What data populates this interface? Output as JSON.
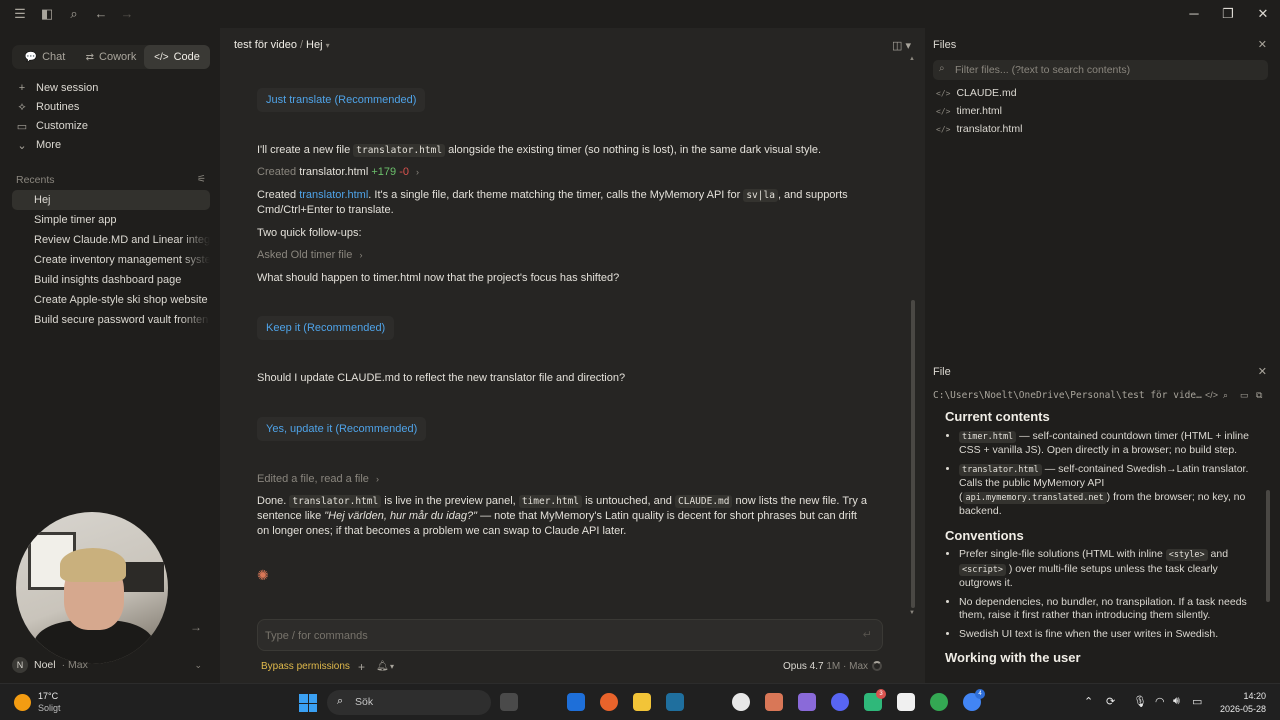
{
  "titlebar": {
    "icons": [
      "menu-icon",
      "sidebar-toggle-icon",
      "search-icon",
      "back-arrow-icon",
      "forward-arrow-icon"
    ],
    "window_controls": {
      "minimize": "─",
      "maximize": "❐",
      "close": "✕"
    }
  },
  "sidebar": {
    "tabs": [
      {
        "label": "Chat",
        "icon": "💬"
      },
      {
        "label": "Cowork",
        "icon": "⇄"
      },
      {
        "label": "Code",
        "icon": "</>",
        "active": true
      }
    ],
    "nav": [
      {
        "label": "New session",
        "icon": "+"
      },
      {
        "label": "Routines",
        "icon": "⟡"
      },
      {
        "label": "Customize",
        "icon": "▭"
      },
      {
        "label": "More",
        "icon": "⌄"
      }
    ],
    "recents_label": "Recents",
    "recents": [
      {
        "label": "Hej",
        "active": true
      },
      {
        "label": "Simple timer app"
      },
      {
        "label": "Review Claude.MD and Linear integr"
      },
      {
        "label": "Create inventory management syste"
      },
      {
        "label": "Build insights dashboard page"
      },
      {
        "label": "Create Apple-style ski shop website"
      },
      {
        "label": "Build secure password vault fronten"
      }
    ],
    "user": {
      "initial": "N",
      "name": "Noel",
      "plan": "Max"
    }
  },
  "main": {
    "breadcrumb": {
      "project": "test för video",
      "separator": "/",
      "session": "Hej"
    },
    "messages": {
      "opt_translate": "Just translate (Recommended)",
      "create_intro_1": "I'll create a new file",
      "create_intro_code": "translator.html",
      "create_intro_2": "alongside the existing timer (so nothing is lost), in the same dark visual style.",
      "created_label": "Created",
      "created_file": "translator.html",
      "created_add": "+179",
      "created_del": "-0",
      "summary_1": "Created",
      "summary_link": "translator.html",
      "summary_2": ". It's a single file, dark theme matching the timer, calls the MyMemory API for",
      "summary_code": "sv|la",
      "summary_3": ", and supports Cmd/Ctrl+Enter to translate.",
      "followups": "Two quick follow-ups:",
      "asked": "Asked Old timer file",
      "question1": "What should happen to timer.html now that the project's focus has shifted?",
      "opt_keep": "Keep it (Recommended)",
      "question2": "Should I update CLAUDE.md to reflect the new translator file and direction?",
      "opt_update": "Yes, update it (Recommended)",
      "edited": "Edited a file, read a file",
      "done_1": "Done.",
      "done_code1": "translator.html",
      "done_2": "is live in the preview panel,",
      "done_code2": "timer.html",
      "done_3": "is untouched, and",
      "done_code3": "CLAUDE.md",
      "done_4": "now lists the new file. Try a sentence like",
      "done_quote": "\"Hej världen, hur mår du idag?\"",
      "done_5": "— note that MyMemory's Latin quality is decent for short phrases but can drift on longer ones; if that becomes a problem we can swap to Claude API later."
    },
    "composer": {
      "placeholder": "Type / for commands"
    },
    "bottom": {
      "bypass": "Bypass permissions",
      "model": "Opus 4.7",
      "model_sub": "1M · Max"
    }
  },
  "files_panel": {
    "title": "Files",
    "search_placeholder": "Filter files... (?text to search contents)",
    "files": [
      "CLAUDE.md",
      "timer.html",
      "translator.html"
    ]
  },
  "file_panel": {
    "title": "File",
    "path": "C:\\Users\\Noelt\\OneDrive\\Personal\\test för video\\CLAUDE.md",
    "sections": {
      "current_heading": "Current contents",
      "c1_code": "timer.html",
      "c1_text": "— self-contained countdown timer (HTML + inline CSS + vanilla JS). Open directly in a browser; no build step.",
      "c2_code": "translator.html",
      "c2_text_1": "— self-contained Swedish→Latin translator. Calls the public MyMemory API (",
      "c2_code2": "api.mymemory.translated.net",
      "c2_text_2": ") from the browser; no key, no backend.",
      "conv_heading": "Conventions",
      "v1_text_1": "Prefer single-file solutions (HTML with inline",
      "v1_code1": "<style>",
      "v1_text_2": "and",
      "v1_code2": "<script>",
      "v1_text_3": ") over multi-file setups unless the task clearly outgrows it.",
      "v2_text": "No dependencies, no bundler, no transpilation. If a task needs them, raise it first rather than introducing them silently.",
      "v3_text": "Swedish UI text is fine when the user writes in Swedish.",
      "work_heading": "Working with the user"
    }
  },
  "taskbar": {
    "weather_temp": "17°C",
    "weather_desc": "Soligt",
    "search_label": "Sök",
    "time": "14:20",
    "date": "2026-05-28",
    "badge_a": "3",
    "badge_b": "4"
  }
}
